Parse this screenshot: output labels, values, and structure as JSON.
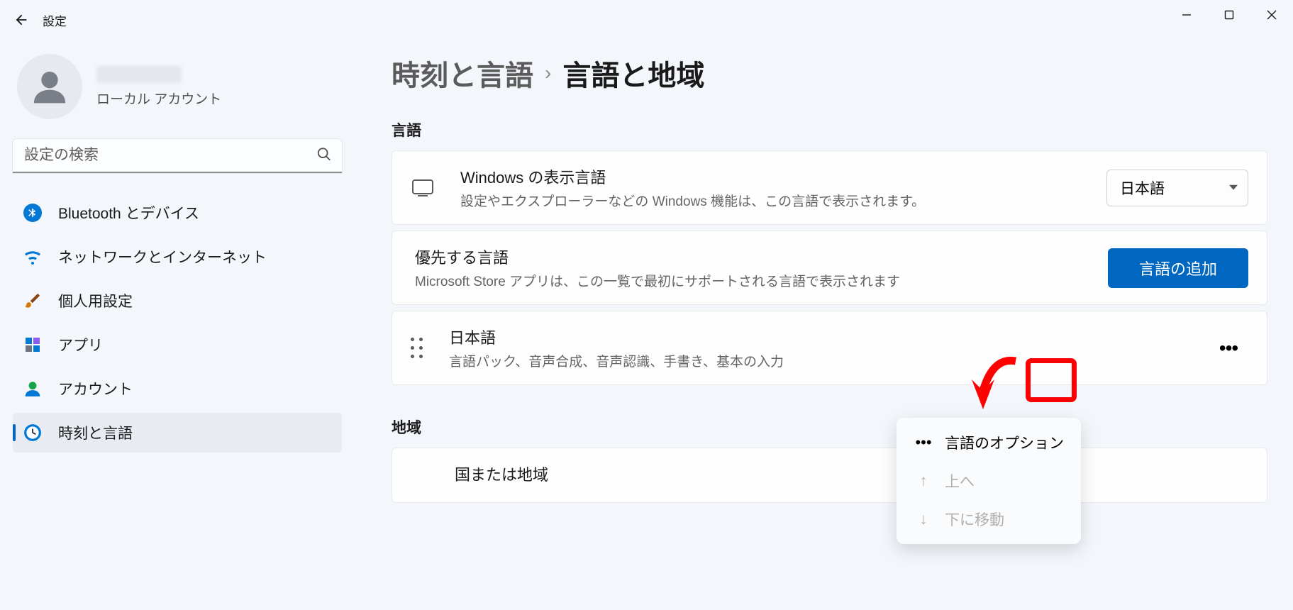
{
  "app": {
    "title": "設定"
  },
  "profile": {
    "account_type": "ローカル アカウント"
  },
  "search": {
    "placeholder": "設定の検索"
  },
  "nav": [
    {
      "label": "Bluetooth とデバイス",
      "icon": "bluetooth"
    },
    {
      "label": "ネットワークとインターネット",
      "icon": "wifi"
    },
    {
      "label": "個人用設定",
      "icon": "brush"
    },
    {
      "label": "アプリ",
      "icon": "apps"
    },
    {
      "label": "アカウント",
      "icon": "account"
    },
    {
      "label": "時刻と言語",
      "icon": "clock",
      "active": true
    }
  ],
  "breadcrumb": {
    "parent": "時刻と言語",
    "current": "言語と地域"
  },
  "sections": {
    "language": {
      "title": "言語",
      "display_language": {
        "title": "Windows の表示言語",
        "desc": "設定やエクスプローラーなどの Windows 機能は、この言語で表示されます。",
        "selected": "日本語"
      },
      "preferred": {
        "title": "優先する言語",
        "desc": "Microsoft Store アプリは、この一覧で最初にサポートされる言語で表示されます",
        "add_btn": "言語の追加"
      },
      "lang_item": {
        "title": "日本語",
        "desc": "言語パック、音声合成、音声認識、手書き、基本の入力"
      }
    },
    "region": {
      "title": "地域",
      "country_title": "国または地域"
    }
  },
  "ctx_menu": {
    "options": "言語のオプション",
    "up": "上へ",
    "down": "下に移動"
  }
}
